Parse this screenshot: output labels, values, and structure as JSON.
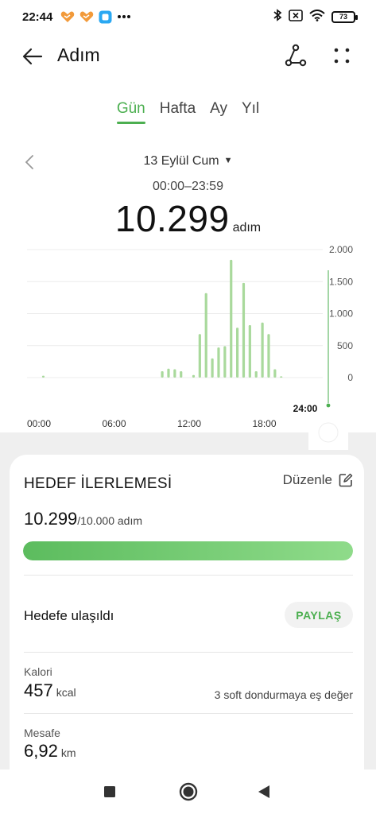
{
  "status_bar": {
    "time": "22:44",
    "battery": "73",
    "icons": [
      "heart-app-icon",
      "heart-app-icon",
      "app-icon",
      "more-notifications-icon",
      "bluetooth-icon",
      "sim-icon",
      "wifi-icon",
      "battery-icon"
    ]
  },
  "app_bar": {
    "title": "Adım",
    "icons": [
      "back-arrow-icon",
      "route-icon",
      "more-dots-icon"
    ]
  },
  "tabs": [
    {
      "label": "Gün",
      "active": true
    },
    {
      "label": "Hafta",
      "active": false
    },
    {
      "label": "Ay",
      "active": false
    },
    {
      "label": "Yıl",
      "active": false
    }
  ],
  "date_header": {
    "date": "13 Eylül Cum",
    "caret": "▼",
    "time_range": "00:00–23:59",
    "total_steps": "10.299",
    "unit": "adım"
  },
  "colors": {
    "accent": "#4caf50",
    "bar": "#a9d99c",
    "sheet": "#efefef"
  },
  "chart_data": {
    "type": "bar",
    "x_tick_labels": [
      "00:00",
      "06:00",
      "12:00",
      "18:00"
    ],
    "x_end_label": "24:00",
    "y_tick_labels": [
      "2.000",
      "1.500",
      "1.000",
      "500",
      "0"
    ],
    "ylim": [
      0,
      2000
    ],
    "grid": true,
    "bars": [
      {
        "hour": 1.3,
        "value": 30
      },
      {
        "hour": 10.8,
        "value": 100
      },
      {
        "hour": 11.3,
        "value": 140
      },
      {
        "hour": 11.8,
        "value": 130
      },
      {
        "hour": 12.3,
        "value": 100
      },
      {
        "hour": 13.3,
        "value": 40
      },
      {
        "hour": 13.8,
        "value": 680
      },
      {
        "hour": 14.3,
        "value": 1320
      },
      {
        "hour": 14.8,
        "value": 300
      },
      {
        "hour": 15.3,
        "value": 470
      },
      {
        "hour": 15.8,
        "value": 490
      },
      {
        "hour": 16.3,
        "value": 1840
      },
      {
        "hour": 16.8,
        "value": 780
      },
      {
        "hour": 17.3,
        "value": 1480
      },
      {
        "hour": 17.8,
        "value": 820
      },
      {
        "hour": 18.3,
        "value": 100
      },
      {
        "hour": 18.8,
        "value": 860
      },
      {
        "hour": 19.3,
        "value": 680
      },
      {
        "hour": 19.8,
        "value": 130
      },
      {
        "hour": 20.3,
        "value": 20
      }
    ]
  },
  "goal_card": {
    "title": "HEDEF İLERLEMESİ",
    "edit_label": "Düzenle",
    "current": "10.299",
    "target_text": "/10.000 adım",
    "progress": 1.0,
    "achieved_text": "Hedefe ulaşıldı",
    "share_label": "PAYLAŞ",
    "calories_label": "Kalori",
    "calories_value": "457",
    "calories_unit": "kcal",
    "calories_note": "3 soft dondurmaya eş değer",
    "distance_label": "Mesafe",
    "distance_value": "6,92",
    "distance_unit": "km"
  },
  "nav_bar": {
    "icons": [
      "recents-square-icon",
      "home-circle-icon",
      "back-triangle-icon"
    ]
  }
}
